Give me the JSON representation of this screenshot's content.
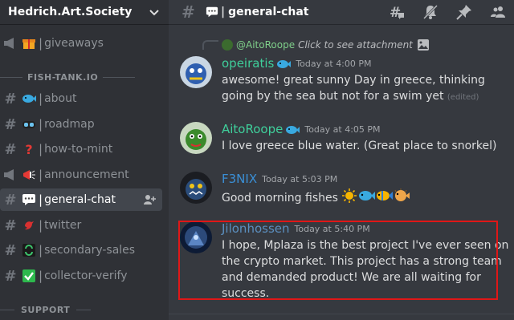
{
  "server": {
    "name": "Hedrich.Art.Society"
  },
  "sidebar": {
    "channels_top": [
      {
        "label": "giveaways",
        "icon": "gift-icon",
        "hash": "announcement-icon"
      }
    ],
    "category_fish": "FISH-TANK.IO",
    "channels": [
      {
        "label": "about",
        "icon": "fish-icon"
      },
      {
        "label": "roadmap",
        "icon": "goggles-icon"
      },
      {
        "label": "how-to-mint",
        "icon": "question-mark-icon"
      },
      {
        "label": "announcement",
        "icon": "megaphone-icon"
      },
      {
        "label": "general-chat",
        "icon": "speech-bubble-icon",
        "active": true
      },
      {
        "label": "twitter",
        "icon": "bird-icon"
      },
      {
        "label": "secondary-sales",
        "icon": "recycle-icon"
      },
      {
        "label": "collector-verify",
        "icon": "check-box-icon"
      }
    ],
    "category_support": "SUPPORT",
    "separator": "|"
  },
  "channel_header": {
    "title": "general-chat",
    "separator": "|"
  },
  "reply_reference": {
    "user": "@AitoRoope",
    "text": "Click to see attachment"
  },
  "messages": [
    {
      "user": "opeiratis",
      "user_color": "#3fcf9b",
      "time": "Today at 4:00 PM",
      "body": "awesome! great sunny Day in greece, thinking going by the sea but not for a swim yet",
      "edited": "(edited)"
    },
    {
      "user": "AitoRoope",
      "user_color": "#3fcf9b",
      "time": "Today at 4:05 PM",
      "body": "I love greece blue water. (Great place to snorkel)"
    },
    {
      "user": "F3NIX",
      "user_color": "#3a8fd6",
      "time": "Today at 5:03 PM",
      "body": "Good morning fishes"
    },
    {
      "user": "Jilonhossen",
      "user_color": "#5b8fbf",
      "time": "Today at 5:40 PM",
      "body": "I hope, Mplaza is the best project I've ever seen on the crypto market. This project has a strong team and demanded product! We are all waiting for success."
    }
  ],
  "colors": {
    "highlight_border": "#e01717",
    "sidebar_bg": "#2f3136",
    "main_bg": "#36393f"
  }
}
